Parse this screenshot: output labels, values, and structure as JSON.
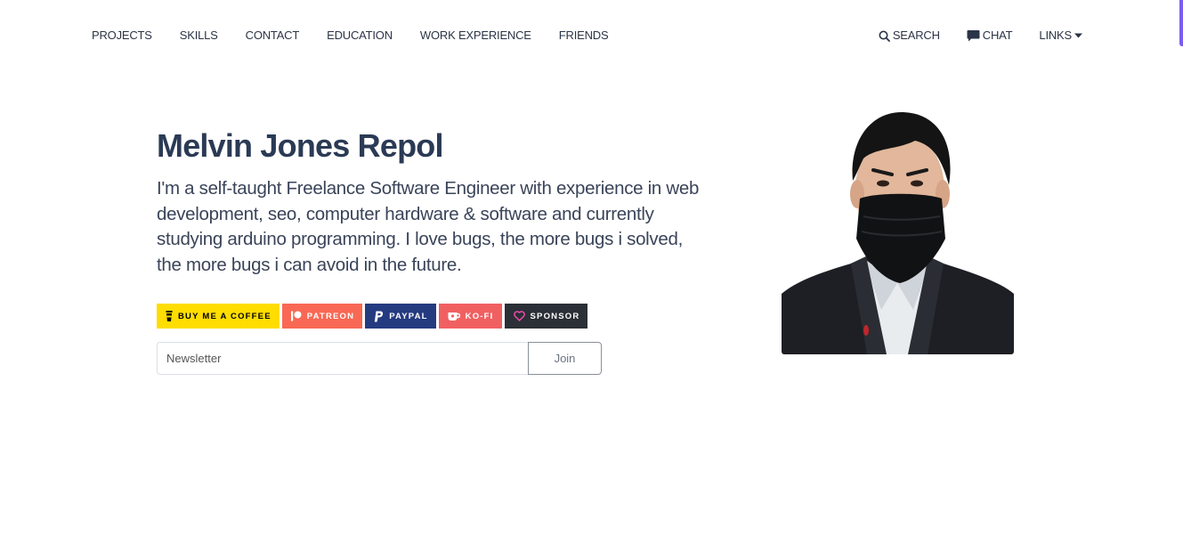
{
  "nav": {
    "left": [
      {
        "label": "PROJECTS"
      },
      {
        "label": "SKILLS"
      },
      {
        "label": "CONTACT"
      },
      {
        "label": "EDUCATION"
      },
      {
        "label": "WORK EXPERIENCE"
      },
      {
        "label": "FRIENDS"
      }
    ],
    "search_label": "SEARCH",
    "chat_label": "CHAT",
    "links_label": "LINKS"
  },
  "hero": {
    "title": "Melvin Jones Repol",
    "description": "I'm a self-taught Freelance Software Engineer with experience in web development, seo, computer hardware & software and currently studying arduino programming. I love bugs, the more bugs i solved, the more bugs i can avoid in the future."
  },
  "badges": [
    {
      "label": "BUY ME A COFFEE",
      "icon": "coffee-icon",
      "bg": "#ffdd00",
      "color": "#000000"
    },
    {
      "label": "PATREON",
      "icon": "patreon-icon",
      "bg": "#f96854",
      "color": "#ffffff"
    },
    {
      "label": "PAYPAL",
      "icon": "paypal-icon",
      "bg": "#00457c",
      "color": "#ffffff"
    },
    {
      "label": "KO-FI",
      "icon": "kofi-icon",
      "bg": "#f16061",
      "color": "#ffffff"
    },
    {
      "label": "SPONSOR",
      "icon": "heart-icon",
      "bg": "#24292e",
      "color": "#ffffff"
    }
  ],
  "newsletter": {
    "placeholder": "Newsletter",
    "join_label": "Join"
  },
  "colors": {
    "text": "#2b3447",
    "accent": "#7b5cf0"
  }
}
